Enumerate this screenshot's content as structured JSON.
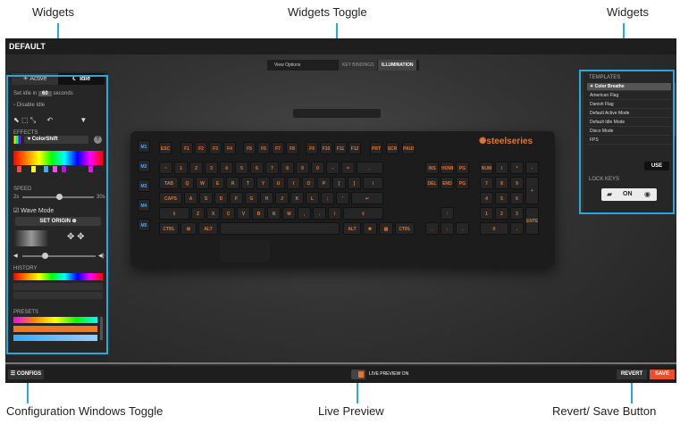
{
  "callouts": {
    "widgets_left": "Widgets",
    "widgets_toggle": "Widgets Toggle",
    "widgets_right": "Widgets",
    "config_toggle": "Configuration Windows Toggle",
    "live_preview": "Live Preview",
    "revert_save": "Revert/ Save Button"
  },
  "app": {
    "profile_name": "DEFAULT",
    "view_options_label": "View Options",
    "view_tabs": [
      "KEY BINDINGS",
      "ILLUMINATION"
    ]
  },
  "left_panel": {
    "tab_active": "Active",
    "tab_idle": "Idle",
    "idle_prefix": "Set idle in",
    "idle_value": "60",
    "idle_suffix": "seconds",
    "disable_idle": "Disable Idle",
    "effects_label": "EFFECTS",
    "effect_value": "ColorShift",
    "speed_label": "SPEED",
    "speed_min": "2s",
    "speed_max": "30s",
    "wave_mode": "Wave Mode",
    "set_origin": "SET ORIGIN",
    "history_label": "HISTORY",
    "presets_label": "PRESETS"
  },
  "keyboard": {
    "logo_text": "steelseries",
    "macro_keys": [
      "M1",
      "M2",
      "M3",
      "M4",
      "M5"
    ],
    "fn_row": [
      "ESC",
      "F1",
      "F2",
      "F3",
      "F4",
      "F5",
      "F6",
      "F7",
      "F8",
      "F9",
      "F10",
      "F11",
      "F12",
      "PRT SCR",
      "SCR LOCK",
      "PAUSE"
    ],
    "row_num": [
      "~",
      "1",
      "2",
      "3",
      "4",
      "5",
      "6",
      "7",
      "8",
      "9",
      "0",
      "-",
      "=",
      "←"
    ],
    "row_q": [
      "TAB",
      "Q",
      "W",
      "E",
      "R",
      "T",
      "Y",
      "U",
      "I",
      "O",
      "P",
      "[",
      "]",
      "\\"
    ],
    "row_a": [
      "CAPS",
      "A",
      "S",
      "D",
      "F",
      "G",
      "H",
      "J",
      "K",
      "L",
      ";",
      "'",
      "↵"
    ],
    "row_z": [
      "⇧",
      "Z",
      "X",
      "C",
      "V",
      "B",
      "N",
      "M",
      ",",
      ".",
      "/",
      "⇧"
    ],
    "row_ctrl": [
      "CTRL",
      "⊞",
      "ALT",
      "ALT",
      "✱",
      "▤",
      "CTRL"
    ],
    "nav_keys": [
      "INS",
      "HOME",
      "PG UP",
      "DEL",
      "END",
      "PG DN"
    ],
    "numpad": [
      "NUM LOCK",
      "/",
      "*",
      "-",
      "7",
      "8",
      "9",
      "+",
      "4",
      "5",
      "6",
      "1",
      "2",
      "3",
      "ENTER",
      "0",
      "."
    ]
  },
  "right_panel": {
    "templates_label": "TEMPLATES",
    "templates": [
      "Color Breathe",
      "American Flag",
      "Danish Flag",
      "Default Active Mode",
      "Default Idle Mode",
      "Disco Mode",
      "FPS"
    ],
    "selected_template": 0,
    "use_button": "USE",
    "lock_keys_label": "LOCK KEYS",
    "lock_state": "ON"
  },
  "bottom": {
    "configs_button": "CONFIGS",
    "live_preview_label": "LIVE PREVIEW ON",
    "revert_button": "REVERT",
    "save_button": "SAVE"
  },
  "colors": {
    "highlight": "#29a8e0",
    "key_legend": "#e8742a",
    "save_button": "#e8502a"
  }
}
